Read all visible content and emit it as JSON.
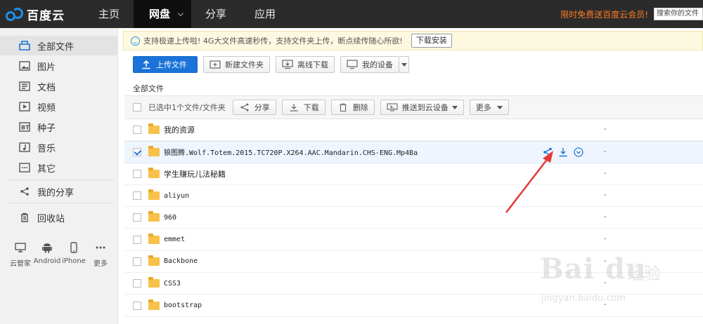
{
  "header": {
    "logo_text": "百度云",
    "nav": [
      {
        "label": "主页"
      },
      {
        "label": "网盘"
      },
      {
        "label": "分享"
      },
      {
        "label": "应用"
      }
    ],
    "promo": "限时免费送百度云会员!",
    "search_text": "搜索你的文件"
  },
  "sidebar": {
    "items": [
      {
        "label": "全部文件",
        "icon": "folder-outline-icon"
      },
      {
        "label": "图片",
        "icon": "image-icon"
      },
      {
        "label": "文档",
        "icon": "document-icon"
      },
      {
        "label": "视频",
        "icon": "video-icon"
      },
      {
        "label": "种子",
        "icon": "bt-icon"
      },
      {
        "label": "音乐",
        "icon": "music-note-icon"
      },
      {
        "label": "其它",
        "icon": "more-dots-icon"
      },
      {
        "label": "我的分享",
        "icon": "share-icon"
      },
      {
        "label": "回收站",
        "icon": "trash-icon"
      }
    ],
    "devices": [
      {
        "label": "云管家",
        "icon": "monitor-icon"
      },
      {
        "label": "Android",
        "icon": "android-icon"
      },
      {
        "label": "iPhone",
        "icon": "phone-icon"
      },
      {
        "label": "更多",
        "icon": "more-icon"
      }
    ]
  },
  "notice": {
    "text": "支持极速上传啦! 4G大文件高速秒传，支持文件夹上传，断点续传随心所欲!",
    "install_label": "下载安装"
  },
  "toolbar": {
    "upload_label": "上传文件",
    "new_folder_label": "新建文件夹",
    "offline_label": "离线下载",
    "devices_label": "我的设备"
  },
  "breadcrumb": "全部文件",
  "list_header": {
    "selected_text": "已选中1个文件/文件夹",
    "share_label": "分享",
    "download_label": "下载",
    "delete_label": "删除",
    "push_label": "推送到云设备",
    "more_label": "更多"
  },
  "files": [
    {
      "name": "我的资源",
      "size": "-",
      "checked": false,
      "cn": true
    },
    {
      "name": "狼图腾.Wolf.Totem.2015.TC720P.X264.AAC.Mandarin.CHS-ENG.Mp4Ba",
      "size": "-",
      "checked": true,
      "cn": false
    },
    {
      "name": "学生赚玩儿法秘籍",
      "size": "-",
      "checked": false,
      "cn": true
    },
    {
      "name": "aliyun",
      "size": "-",
      "checked": false,
      "cn": false
    },
    {
      "name": "960",
      "size": "-",
      "checked": false,
      "cn": false
    },
    {
      "name": "emmet",
      "size": "-",
      "checked": false,
      "cn": false
    },
    {
      "name": "Backbone",
      "size": "-",
      "checked": false,
      "cn": false
    },
    {
      "name": "CSS3",
      "size": "-",
      "checked": false,
      "cn": false
    },
    {
      "name": "bootstrap",
      "size": "-",
      "checked": false,
      "cn": false
    }
  ],
  "watermark": {
    "brand": "Bai du",
    "cn": "经验",
    "url": "jingyan.baidu.com"
  },
  "colors": {
    "accent": "#1a73d8",
    "topbar": "#2b2b2b",
    "promo": "#ff7b22",
    "annotation": "#e53935"
  }
}
